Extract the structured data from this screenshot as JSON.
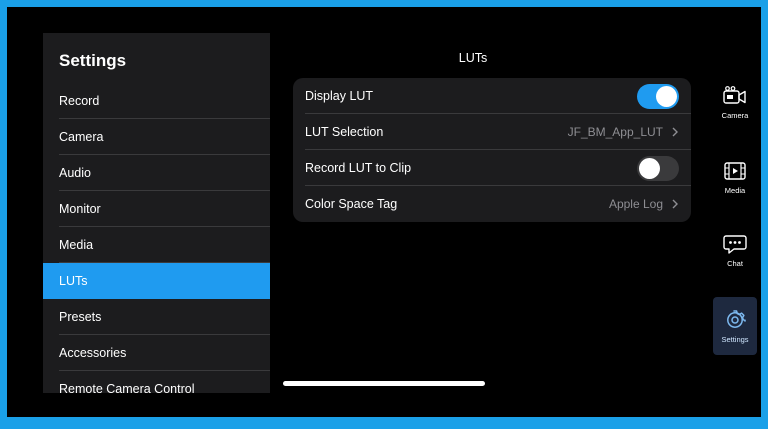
{
  "sidebar": {
    "title": "Settings",
    "items": [
      {
        "label": "Record"
      },
      {
        "label": "Camera"
      },
      {
        "label": "Audio"
      },
      {
        "label": "Monitor"
      },
      {
        "label": "Media"
      },
      {
        "label": "LUTs",
        "active": true
      },
      {
        "label": "Presets"
      },
      {
        "label": "Accessories"
      },
      {
        "label": "Remote Camera Control"
      }
    ]
  },
  "main": {
    "title": "LUTs",
    "rows": {
      "display_lut": {
        "label": "Display LUT",
        "toggle": "on"
      },
      "lut_selection": {
        "label": "LUT Selection",
        "value": "JF_BM_App_LUT"
      },
      "record_lut": {
        "label": "Record LUT to Clip",
        "toggle": "off"
      },
      "color_space": {
        "label": "Color Space Tag",
        "value": "Apple Log"
      }
    }
  },
  "rail": {
    "camera": "Camera",
    "media": "Media",
    "chat": "Chat",
    "settings": "Settings",
    "active": "settings"
  },
  "colors": {
    "accent": "#1f9bf0",
    "background": "#000000",
    "panel": "#1c1c1e",
    "frame": "#1aa0e8"
  }
}
